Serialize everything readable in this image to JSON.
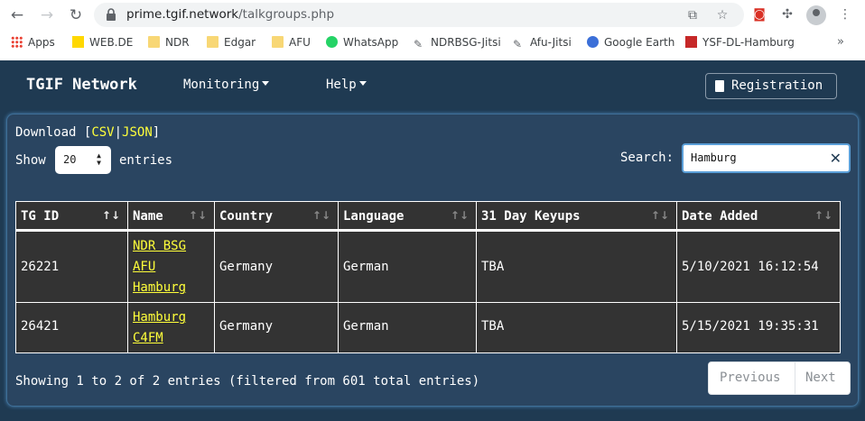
{
  "browser": {
    "url_host": "prime.tgif.network",
    "url_path": "/talkgroups.php",
    "bookmarks": [
      "Apps",
      "WEB.DE",
      "NDR",
      "Edgar",
      "AFU",
      "WhatsApp",
      "NDRBSG-Jitsi",
      "Afu-Jitsi",
      "Google Earth",
      "YSF-DL-Hamburg"
    ],
    "more_glyph": "»",
    "icons": [
      "back-icon",
      "forward-icon",
      "reload-icon",
      "lock-icon",
      "translate-icon",
      "star-icon",
      "extension-icon",
      "puzzle-icon",
      "profile-icon",
      "menu-kebab-icon"
    ]
  },
  "navbar": {
    "brand": "TGIF Network",
    "menu": [
      "Monitoring",
      "Help"
    ],
    "register": "Registration"
  },
  "toolbar": {
    "download_label": "Download",
    "bracket_open": "[",
    "csv": "CSV",
    "sep": "|",
    "json": "JSON",
    "bracket_close": "]",
    "show_label": "Show",
    "page_size": "20",
    "entries_label": "entries",
    "search_label": "Search:",
    "search_value": "Hamburg"
  },
  "table": {
    "columns": [
      "TG ID",
      "Name",
      "Country",
      "Language",
      "31 Day Keyups",
      "Date Added"
    ],
    "sort_glyph": "↑↓",
    "rows": [
      {
        "tg_id": "26221",
        "name_lines": [
          "NDR BSG",
          "AFU",
          "Hamburg"
        ],
        "country": "Germany",
        "language": "German",
        "keyups": "TBA",
        "date_added": "5/10/2021 16:12:54"
      },
      {
        "tg_id": "26421",
        "name_lines": [
          "Hamburg",
          "C4FM"
        ],
        "country": "Germany",
        "language": "German",
        "keyups": "TBA",
        "date_added": "5/15/2021 19:35:31"
      }
    ]
  },
  "footer": {
    "info": "Showing 1 to 2 of 2 entries (filtered from 601 total entries)",
    "previous": "Previous",
    "next": "Next"
  },
  "colors": {
    "page_bg": "#1f3a52",
    "card_bg": "#2a4561",
    "table_bg": "#333333",
    "link": "#ffff3a"
  }
}
